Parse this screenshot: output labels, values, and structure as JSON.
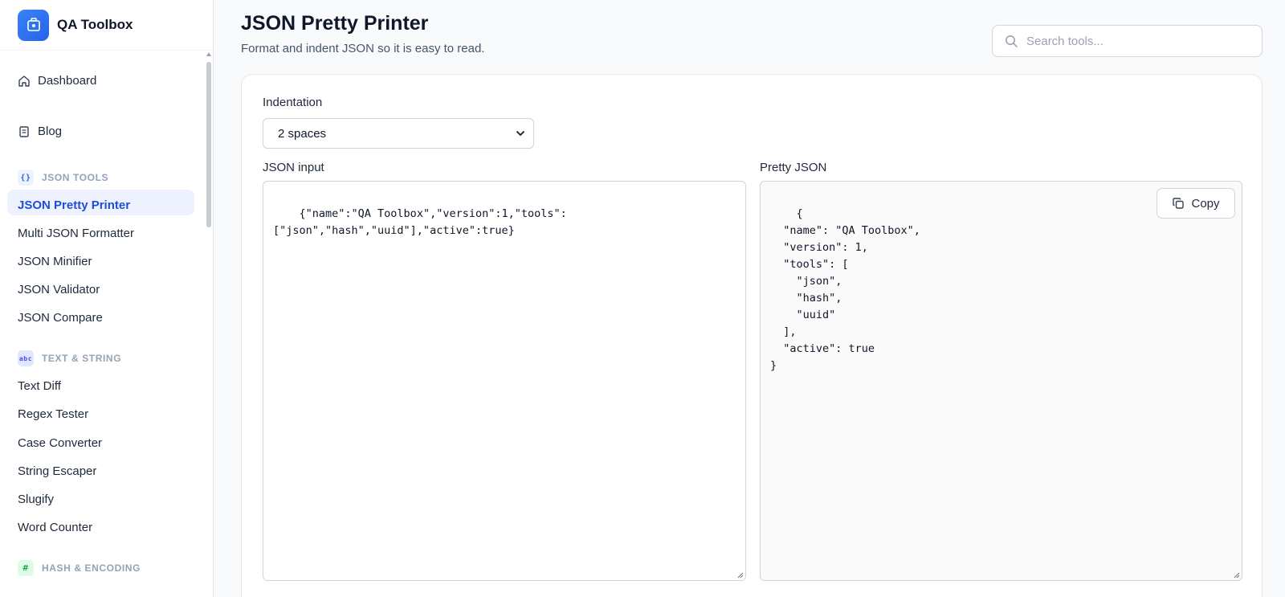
{
  "brand": {
    "name": "QA Toolbox"
  },
  "sidebar": {
    "top_items": [
      {
        "label": "Dashboard",
        "icon": "home-icon"
      },
      {
        "label": "Blog",
        "icon": "document-icon"
      }
    ],
    "sections": [
      {
        "title": "JSON TOOLS",
        "icon": "braces-icon",
        "items": [
          "JSON Pretty Printer",
          "Multi JSON Formatter",
          "JSON Minifier",
          "JSON Validator",
          "JSON Compare"
        ]
      },
      {
        "title": "TEXT & STRING",
        "icon": "text-icon",
        "items": [
          "Text Diff",
          "Regex Tester",
          "Case Converter",
          "String Escaper",
          "Slugify",
          "Word Counter"
        ]
      },
      {
        "title": "HASH & ENCODING",
        "icon": "hash-icon",
        "items": []
      }
    ],
    "active_item": "JSON Pretty Printer"
  },
  "page": {
    "title": "JSON Pretty Printer",
    "subtitle": "Format and indent JSON so it is easy to read."
  },
  "search": {
    "placeholder": "Search tools..."
  },
  "form": {
    "indentation_label": "Indentation",
    "indentation_value": "2 spaces",
    "input_label": "JSON input",
    "input_value": "{\"name\":\"QA Toolbox\",\"version\":1,\"tools\":\n[\"json\",\"hash\",\"uuid\"],\"active\":true}",
    "output_label": "Pretty JSON",
    "output_value": "{\n  \"name\": \"QA Toolbox\",\n  \"version\": 1,\n  \"tools\": [\n    \"json\",\n    \"hash\",\n    \"uuid\"\n  ],\n  \"active\": true\n}",
    "copy_label": "Copy"
  },
  "colors": {
    "accent": "#2563eb",
    "active_bg": "#eef2ff"
  }
}
